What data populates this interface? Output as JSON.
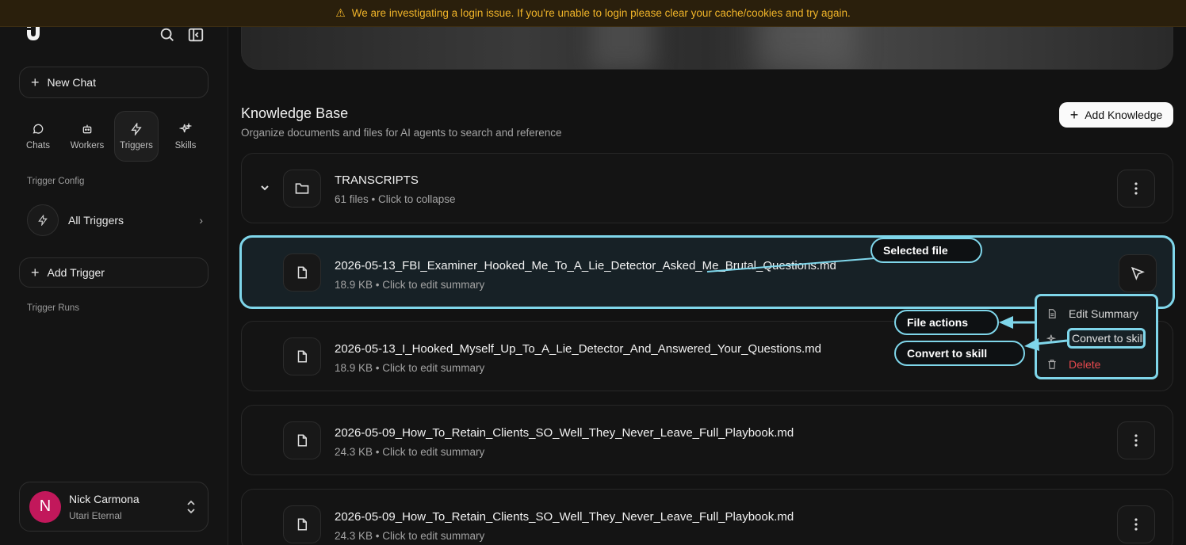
{
  "banner": {
    "icon": "warning-icon",
    "text": "We are investigating a login issue. If you're unable to login please clear your cache/cookies and try again.",
    "color": "#f0b429"
  },
  "sidebar": {
    "new_chat": "New Chat",
    "nav": [
      {
        "label": "Chats",
        "icon": "chat-bubble-icon"
      },
      {
        "label": "Workers",
        "icon": "robot-icon"
      },
      {
        "label": "Triggers",
        "icon": "lightning-icon",
        "active": true
      },
      {
        "label": "Skills",
        "icon": "sparkles-icon"
      }
    ],
    "trigger_config_label": "Trigger Config",
    "all_triggers": "All Triggers",
    "add_trigger": "Add Trigger",
    "trigger_runs_label": "Trigger Runs",
    "user": {
      "initial": "N",
      "name": "Nick Carmona",
      "org": "Utari Eternal",
      "avatar_color": "#c2185b"
    }
  },
  "main": {
    "title": "Knowledge Base",
    "subtitle": "Organize documents and files for AI agents to search and reference",
    "add_knowledge": "Add Knowledge",
    "folder": {
      "name": "TRANSCRIPTS",
      "meta": "61 files • Click to collapse"
    },
    "files": [
      {
        "name": "2026-05-13_FBI_Examiner_Hooked_Me_To_A_Lie_Detector_Asked_Me_Brutal_Questions.md",
        "meta": "18.9 KB • Click to edit summary",
        "selected": true
      },
      {
        "name": "2026-05-13_I_Hooked_Myself_Up_To_A_Lie_Detector_And_Answered_Your_Questions.md",
        "meta": "18.9 KB • Click to edit summary"
      },
      {
        "name": "2026-05-09_How_To_Retain_Clients_SO_Well_They_Never_Leave_Full_Playbook.md",
        "meta": "24.3 KB • Click to edit summary"
      },
      {
        "name": "2026-05-09_How_To_Retain_Clients_SO_Well_They_Never_Leave_Full_Playbook.md",
        "meta": "24.3 KB • Click to edit summary"
      }
    ],
    "menu": {
      "edit_summary": "Edit Summary",
      "convert": "Convert to skill",
      "delete": "Delete"
    }
  },
  "annotations": {
    "selected_file": "Selected file",
    "file_actions": "File actions",
    "convert_to_skill": "Convert to skill",
    "accent": "#7fd6ea"
  }
}
